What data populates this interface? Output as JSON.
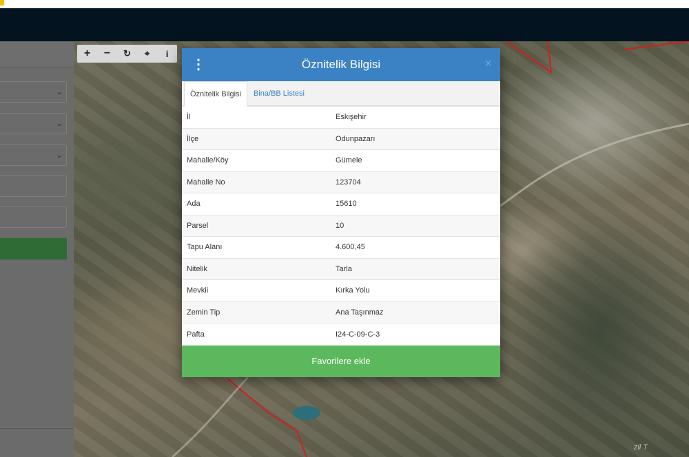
{
  "colors": {
    "header_bg": "#03131f",
    "modal_header": "#3a82c4",
    "favorite_button": "#5cb85c",
    "parcel_boundary": "#d21f1f"
  },
  "toolbar": {
    "zoom_in": "+",
    "zoom_out": "−",
    "refresh": "↻",
    "locate": "⌖",
    "info": "i"
  },
  "modal": {
    "title": "Öznitelik Bilgisi",
    "menu_icon": "⋮",
    "close_icon": "×",
    "tabs": [
      {
        "label": "Öznitelik Bilgisi",
        "active": true
      },
      {
        "label": "Bina/BB Listesi",
        "active": false
      }
    ],
    "rows": [
      {
        "key": "İl",
        "value": "Eskişehir"
      },
      {
        "key": "İlçe",
        "value": "Odunpazarı"
      },
      {
        "key": "Mahalle/Köy",
        "value": "Gümele"
      },
      {
        "key": "Mahalle No",
        "value": "123704"
      },
      {
        "key": "Ada",
        "value": "15610"
      },
      {
        "key": "Parsel",
        "value": "10"
      },
      {
        "key": "Tapu Alanı",
        "value": "4.600,45"
      },
      {
        "key": "Nitelik",
        "value": "Tarla"
      },
      {
        "key": "Mevkii",
        "value": "Kırka Yolu"
      },
      {
        "key": "Zemin Tip",
        "value": "Ana Taşınmaz"
      },
      {
        "key": "Pafta",
        "value": "I24-C-09-C-3"
      }
    ],
    "favorite_label": "Favorilere ekle"
  },
  "sidebar": {
    "select_chevron": "⌄"
  },
  "map": {
    "attribution": "zll T"
  }
}
